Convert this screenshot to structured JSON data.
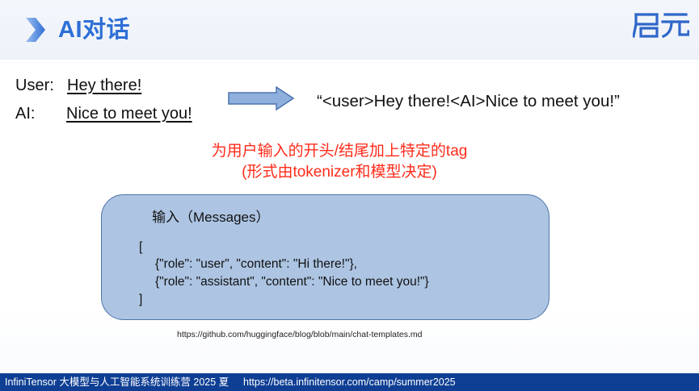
{
  "header": {
    "title": "AI对话",
    "logo_text": "启元",
    "chevron_icon": "chevron-right-icon",
    "accent_color": "#2e6fd6"
  },
  "dialogue": {
    "user_label": "User:",
    "user_text": "Hey there!",
    "ai_label": "AI:",
    "ai_text": "Nice to meet you!",
    "arrow_icon": "right-arrow-icon",
    "template_string": "“<user>Hey there!<AI>Nice to meet you!”"
  },
  "note": {
    "line1": "为用户输入的开头/结尾加上特定的tag",
    "line2": "(形式由tokenizer和模型决定)",
    "color": "#ff2b1a"
  },
  "messages": {
    "title": "输入（Messages）",
    "open_bracket": "[",
    "line1": "{\"role\": \"user\", \"content\": \"Hi there!\"},",
    "line2": "{\"role\": \"assistant\", \"content\": \"Nice to meet you!\"}",
    "close_bracket": "]",
    "box_color": "#adc5e3"
  },
  "source_url": "https://github.com/huggingface/blog/blob/main/chat-templates.md",
  "footer": {
    "left_text": "InfiniTensor 大模型与人工智能系统训练营 2025 夏",
    "right_text": "https://beta.infinitensor.com/camp/summer2025",
    "background_color": "#0f3f94"
  }
}
